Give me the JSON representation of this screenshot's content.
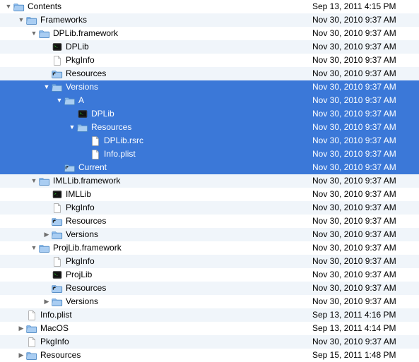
{
  "rows": [
    {
      "indent": 0,
      "arrow": "down",
      "icon": "folder",
      "name": "Contents",
      "date": "Sep 13, 2011 4:15 PM",
      "sel": false
    },
    {
      "indent": 1,
      "arrow": "down",
      "icon": "folder",
      "name": "Frameworks",
      "date": "Nov 30, 2010 9:37 AM",
      "sel": false
    },
    {
      "indent": 2,
      "arrow": "down",
      "icon": "folder",
      "name": "DPLib.framework",
      "date": "Nov 30, 2010 9:37 AM",
      "sel": false
    },
    {
      "indent": 3,
      "arrow": "none",
      "icon": "exec",
      "name": "DPLib",
      "date": "Nov 30, 2010 9:37 AM",
      "sel": false
    },
    {
      "indent": 3,
      "arrow": "none",
      "icon": "doc",
      "name": "PkgInfo",
      "date": "Nov 30, 2010 9:37 AM",
      "sel": false
    },
    {
      "indent": 3,
      "arrow": "none",
      "icon": "alias",
      "name": "Resources",
      "date": "Nov 30, 2010 9:37 AM",
      "sel": false
    },
    {
      "indent": 3,
      "arrow": "down",
      "icon": "folder",
      "name": "Versions",
      "date": "Nov 30, 2010 9:37 AM",
      "sel": true
    },
    {
      "indent": 4,
      "arrow": "down",
      "icon": "folder",
      "name": "A",
      "date": "Nov 30, 2010 9:37 AM",
      "sel": true
    },
    {
      "indent": 5,
      "arrow": "none",
      "icon": "exec",
      "name": "DPLib",
      "date": "Nov 30, 2010 9:37 AM",
      "sel": true
    },
    {
      "indent": 5,
      "arrow": "down",
      "icon": "folder",
      "name": "Resources",
      "date": "Nov 30, 2010 9:37 AM",
      "sel": true
    },
    {
      "indent": 6,
      "arrow": "none",
      "icon": "doc",
      "name": "DPLib.rsrc",
      "date": "Nov 30, 2010 9:37 AM",
      "sel": true
    },
    {
      "indent": 6,
      "arrow": "none",
      "icon": "doc",
      "name": "Info.plist",
      "date": "Nov 30, 2010 9:37 AM",
      "sel": true
    },
    {
      "indent": 4,
      "arrow": "none",
      "icon": "alias",
      "name": "Current",
      "date": "Nov 30, 2010 9:37 AM",
      "sel": true
    },
    {
      "indent": 2,
      "arrow": "down",
      "icon": "folder",
      "name": "IMLLib.framework",
      "date": "Nov 30, 2010 9:37 AM",
      "sel": false
    },
    {
      "indent": 3,
      "arrow": "none",
      "icon": "exec",
      "name": "IMLLib",
      "date": "Nov 30, 2010 9:37 AM",
      "sel": false
    },
    {
      "indent": 3,
      "arrow": "none",
      "icon": "doc",
      "name": "PkgInfo",
      "date": "Nov 30, 2010 9:37 AM",
      "sel": false
    },
    {
      "indent": 3,
      "arrow": "none",
      "icon": "alias",
      "name": "Resources",
      "date": "Nov 30, 2010 9:37 AM",
      "sel": false
    },
    {
      "indent": 3,
      "arrow": "right",
      "icon": "folder",
      "name": "Versions",
      "date": "Nov 30, 2010 9:37 AM",
      "sel": false
    },
    {
      "indent": 2,
      "arrow": "down",
      "icon": "folder",
      "name": "ProjLib.framework",
      "date": "Nov 30, 2010 9:37 AM",
      "sel": false
    },
    {
      "indent": 3,
      "arrow": "none",
      "icon": "doc",
      "name": "PkgInfo",
      "date": "Nov 30, 2010 9:37 AM",
      "sel": false
    },
    {
      "indent": 3,
      "arrow": "none",
      "icon": "exec",
      "name": "ProjLib",
      "date": "Nov 30, 2010 9:37 AM",
      "sel": false
    },
    {
      "indent": 3,
      "arrow": "none",
      "icon": "alias",
      "name": "Resources",
      "date": "Nov 30, 2010 9:37 AM",
      "sel": false
    },
    {
      "indent": 3,
      "arrow": "right",
      "icon": "folder",
      "name": "Versions",
      "date": "Nov 30, 2010 9:37 AM",
      "sel": false
    },
    {
      "indent": 1,
      "arrow": "none",
      "icon": "doc",
      "name": "Info.plist",
      "date": "Sep 13, 2011 4:16 PM",
      "sel": false
    },
    {
      "indent": 1,
      "arrow": "right",
      "icon": "folder",
      "name": "MacOS",
      "date": "Sep 13, 2011 4:14 PM",
      "sel": false
    },
    {
      "indent": 1,
      "arrow": "none",
      "icon": "doc",
      "name": "PkgInfo",
      "date": "Nov 30, 2010 9:37 AM",
      "sel": false
    },
    {
      "indent": 1,
      "arrow": "right",
      "icon": "folder",
      "name": "Resources",
      "date": "Sep 15, 2011 1:48 PM",
      "sel": false
    }
  ]
}
